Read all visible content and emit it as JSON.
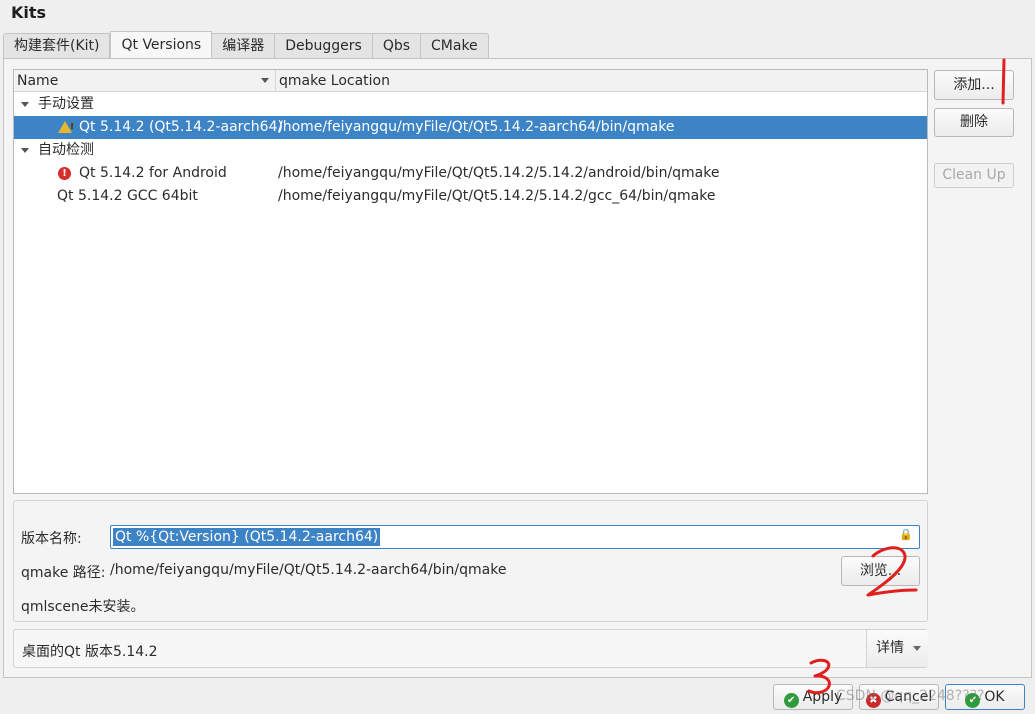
{
  "section_title": "Kits",
  "tabs": [
    {
      "label": "构建套件(Kit)",
      "active": false
    },
    {
      "label": "Qt Versions",
      "active": true
    },
    {
      "label": "编译器",
      "active": false
    },
    {
      "label": "Debuggers",
      "active": false
    },
    {
      "label": "Qbs",
      "active": false
    },
    {
      "label": "CMake",
      "active": false
    }
  ],
  "tree": {
    "columns": {
      "name": "Name",
      "location": "qmake Location"
    },
    "groups": [
      {
        "label": "手动设置",
        "rows": [
          {
            "name": "Qt 5.14.2 (Qt5.14.2-aarch64)",
            "location": "/home/feiyangqu/myFile/Qt/Qt5.14.2-aarch64/bin/qmake",
            "icon": "warning-icon",
            "selected": true
          }
        ]
      },
      {
        "label": "自动检测",
        "rows": [
          {
            "name": "Qt 5.14.2 for Android",
            "location": "/home/feiyangqu/myFile/Qt/Qt5.14.2/5.14.2/android/bin/qmake",
            "icon": "error-icon",
            "selected": false
          },
          {
            "name": "Qt 5.14.2 GCC 64bit",
            "location": "/home/feiyangqu/myFile/Qt/Qt5.14.2/5.14.2/gcc_64/bin/qmake",
            "icon": "",
            "selected": false
          }
        ]
      }
    ]
  },
  "side_buttons": {
    "add": "添加...",
    "remove": "删除",
    "cleanup": "Clean Up"
  },
  "details": {
    "version_name_label": "版本名称:",
    "version_name_value": "Qt %{Qt:Version} (Qt5.14.2-aarch64)",
    "qmake_path_label": "qmake 路径:",
    "qmake_path_value": "/home/feiyangqu/myFile/Qt/Qt5.14.2-aarch64/bin/qmake",
    "browse_button": "浏览...",
    "qmlscene_status": "qmlscene未安装。"
  },
  "info_bar": {
    "text": "桌面的Qt 版本5.14.2",
    "details_button": "详情"
  },
  "dialog_buttons": {
    "apply": "Apply",
    "cancel": "Cancel",
    "ok": "OK"
  },
  "watermark": "CSDN @qq_2248????",
  "annotations": [
    "1",
    "2",
    "3"
  ],
  "colors": {
    "selection": "#3d84c6",
    "annotation": "#e01f1f",
    "ok_icon": "#2f9b3a",
    "cancel_icon": "#c82a2a",
    "warning_icon": "#e6b630",
    "error_icon": "#d92c2c"
  }
}
